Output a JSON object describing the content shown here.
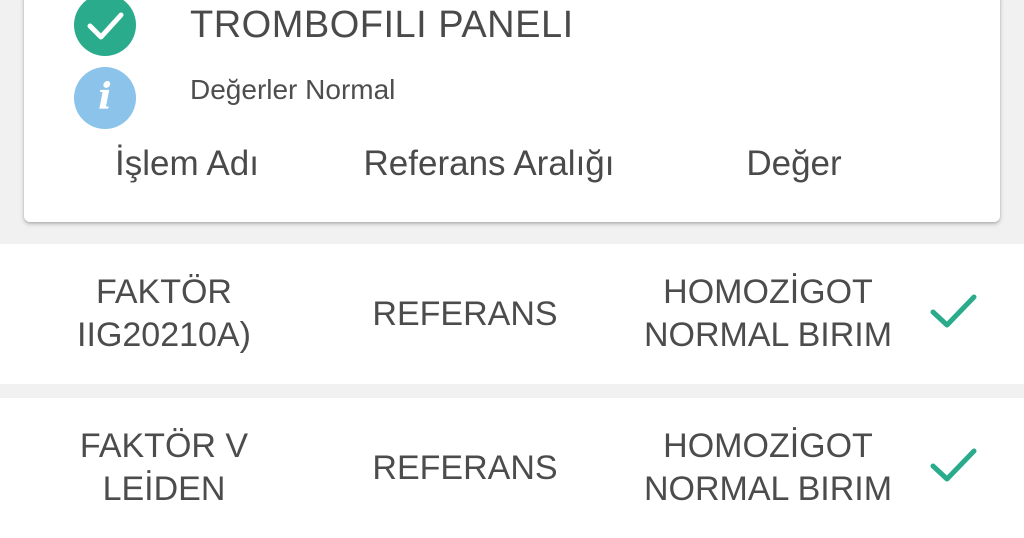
{
  "panel": {
    "title": "TROMBOFILI PANELI",
    "status_text": "Değerler Normal",
    "status_icon": "check-circle-icon",
    "info_icon": "info-icon",
    "info_glyph": "i"
  },
  "columns": {
    "name": "İşlem Adı",
    "range": "Referans Aralığı",
    "value": "Değer"
  },
  "rows": [
    {
      "name_line1": "FAKTÖR",
      "name_line2": "IIG20210A)",
      "range": "REFERANS",
      "value_line1": "HOMOZİGOT",
      "value_line2": "NORMAL BIRIM",
      "status_icon": "check-icon"
    },
    {
      "name_line1": "FAKTÖR V",
      "name_line2": "LEİDEN",
      "range": "REFERANS",
      "value_line1": "HOMOZİGOT",
      "value_line2": "NORMAL BIRIM",
      "status_icon": "check-icon"
    }
  ],
  "colors": {
    "accent_green": "#2aac8c",
    "info_blue": "#8cc3ea",
    "text": "#4a4a4a",
    "background": "#f1f1f1"
  }
}
